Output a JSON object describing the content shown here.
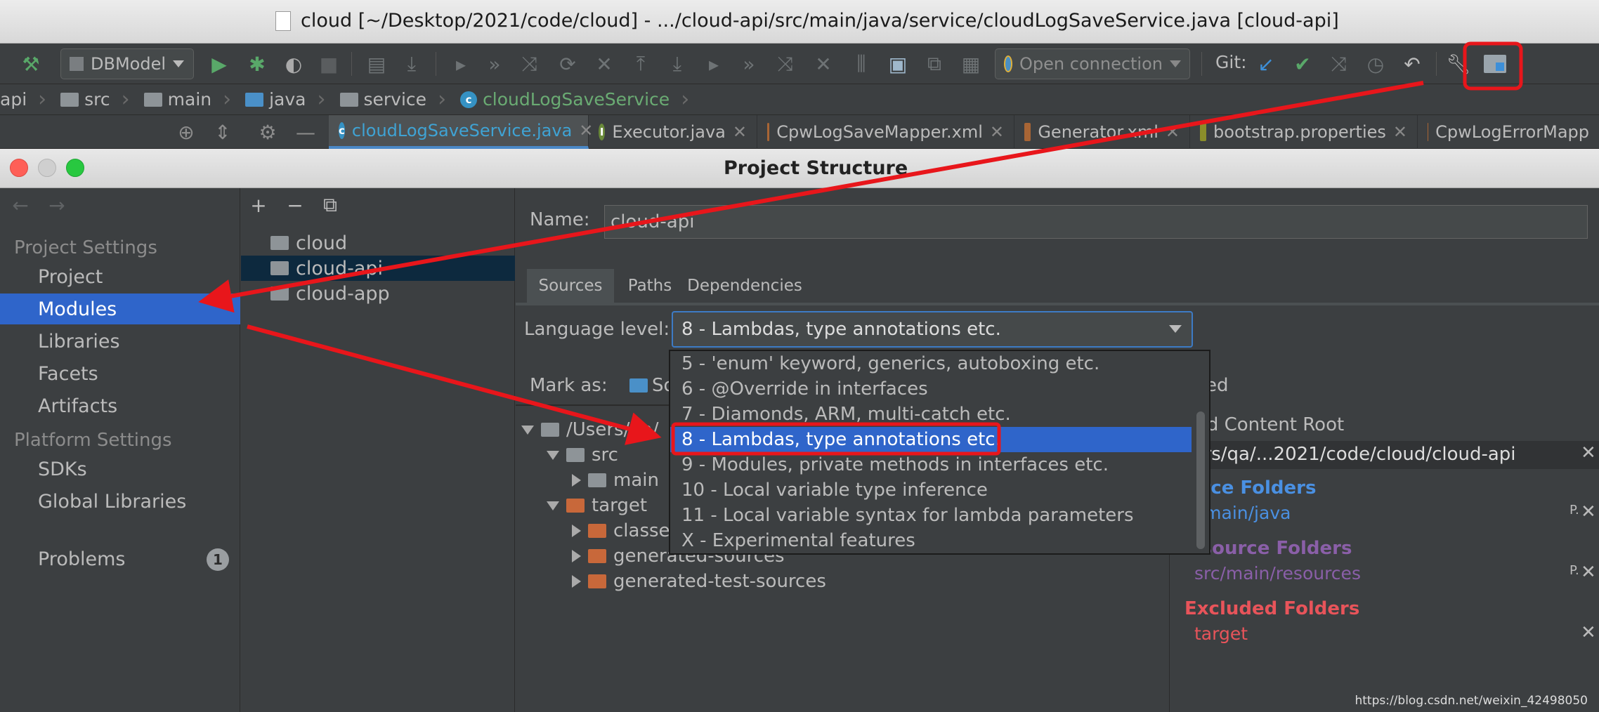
{
  "window": {
    "title": "cloud [~/Desktop/2021/code/cloud] - .../cloud-api/src/main/java/service/cloudLogSaveService.java [cloud-api]"
  },
  "toolbar": {
    "run_config": "DBModel",
    "connection": "Open connection",
    "git_label": "Git:"
  },
  "breadcrumb": {
    "items": [
      "api",
      "src",
      "main",
      "java",
      "service",
      "cloudLogSaveService"
    ]
  },
  "editor_tabs": [
    {
      "label": "cloudLogSaveService.java",
      "active": true
    },
    {
      "label": "Executor.java"
    },
    {
      "label": "CpwLogSaveMapper.xml"
    },
    {
      "label": "Generator.xml"
    },
    {
      "label": "bootstrap.properties"
    },
    {
      "label": "CpwLogErrorMapp"
    }
  ],
  "dialog": {
    "title": "Project Structure",
    "nav": {
      "project_settings_header": "Project Settings",
      "project_settings": [
        "Project",
        "Modules",
        "Libraries",
        "Facets",
        "Artifacts"
      ],
      "selected": "Modules",
      "platform_settings_header": "Platform Settings",
      "platform_settings": [
        "SDKs",
        "Global Libraries"
      ],
      "problems_label": "Problems",
      "problems_count": "1"
    },
    "modules": {
      "toolbar": [
        "+",
        "−",
        "⧉"
      ],
      "items": [
        "cloud",
        "cloud-api",
        "cloud-app"
      ],
      "selected": "cloud-api"
    },
    "details": {
      "name_label": "Name:",
      "name_value": "cloud-api",
      "tabs": [
        "Sources",
        "Paths",
        "Dependencies"
      ],
      "active_tab": "Sources",
      "language_level_label": "Language level:",
      "language_level_value": "8 - Lambdas, type annotations etc.",
      "mark_as_label": "Mark as:",
      "mark_as_partial": "So",
      "excluded_partial": "ed",
      "tree": {
        "root": "/Users/qa/",
        "src": "src",
        "main": "main",
        "target": "target",
        "classes": "classe",
        "generated_sources": "generated-sources",
        "generated_test_sources": "generated-test-sources"
      },
      "content_roots": {
        "add_content_root": "Add Content Root",
        "path": "sers/qa/...2021/code/cloud/cloud-api",
        "source_folders_header": "urce Folders",
        "source_folder": "c/main/java",
        "resource_folders_header": "esource Folders",
        "resource_folder": "src/main/resources",
        "excluded_folders_header": "Excluded Folders",
        "excluded_folder": "target",
        "pkg_marker": "P."
      },
      "language_options": [
        "5 - 'enum' keyword, generics, autoboxing etc.",
        "6 - @Override in interfaces",
        "7 - Diamonds, ARM, multi-catch etc.",
        "8 - Lambdas, type annotations etc.",
        "9 - Modules, private methods in interfaces etc.",
        "10 - Local variable type inference",
        "11 - Local variable syntax for lambda parameters",
        "X - Experimental features"
      ],
      "selected_option_index": 3
    }
  },
  "watermark": "https://blog.csdn.net/weixin_42498050",
  "colors": {
    "selection_blue": "#2f65ca",
    "annotation_red": "#e8161b",
    "source_folder_blue": "#4a90e2",
    "resource_folder_purple": "#8a5fa8",
    "excluded_red": "#e8545a"
  }
}
